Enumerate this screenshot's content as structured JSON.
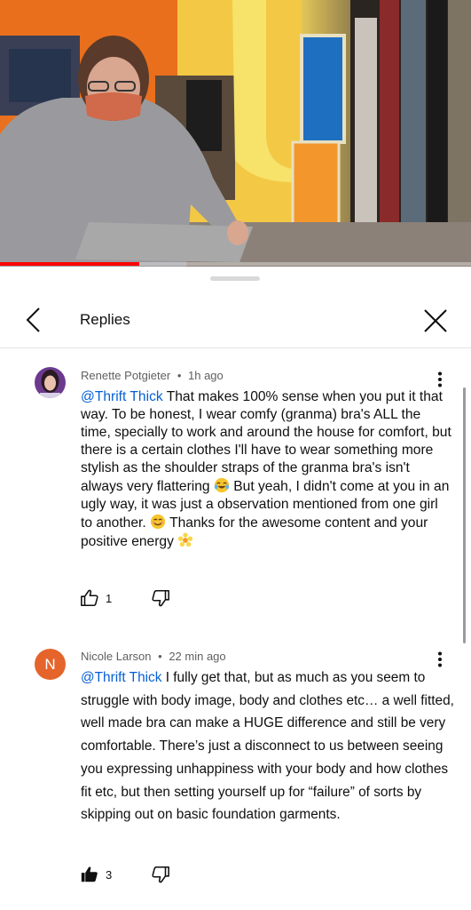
{
  "video": {
    "playback_progress_percent": 29.6
  },
  "header": {
    "title": "Replies",
    "back_icon": "chevron-left-icon",
    "close_icon": "close-icon"
  },
  "comments": [
    {
      "author": "Renette Potgieter",
      "separator": "•",
      "time": "1h ago",
      "mention": "@Thrift Thick",
      "text_parts": [
        " That makes 100% sense when you put it that way. To be honest, I wear comfy (granma) bra's ALL the time, specially to work and around the house for comfort, but there is a certain clothes I'll have to wear something more stylish as the shoulder straps of the granma bra's isn't always very flattering ",
        " But yeah, I didn't come at you in an ugly way, it was just a observation mentioned from one girl to another. ",
        " Thanks for the awesome content and your positive energy "
      ],
      "emojis": [
        "tears-of-joy-emoji",
        "smiling-face-emoji",
        "blossom-emoji"
      ],
      "likes": "1",
      "liked": false
    },
    {
      "author": "Nicole Larson",
      "avatar_letter": "N",
      "avatar_color": "#e5642b",
      "separator": "•",
      "time": "22 min ago",
      "mention": "@Thrift Thick",
      "text": " I fully get that, but as much as you seem to struggle with body image, body and clothes etc… a well fitted, well made bra can make a HUGE difference and still be very comfortable. There’s just a disconnect to us between seeing you expressing unhappiness with your body and how clothes fit etc, but then setting yourself up for “failure” of sorts by skipping out on basic foundation garments.",
      "likes": "3",
      "liked": true
    }
  ],
  "colors": {
    "mention": "#065fd4",
    "progress": "#ff0000",
    "meta_text": "#606060"
  }
}
